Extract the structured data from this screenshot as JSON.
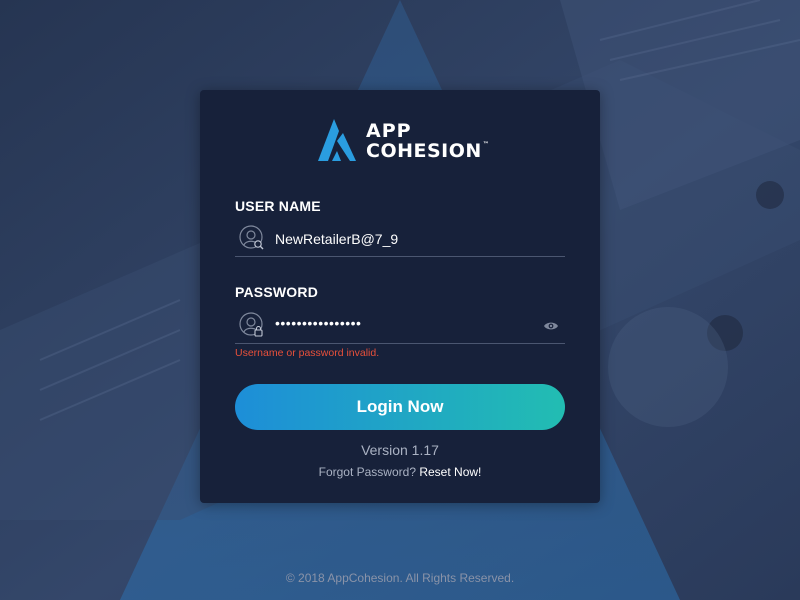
{
  "brand": {
    "logo_line1": "APP",
    "logo_line2": "COHESION",
    "logo_tm": "™",
    "accent_color": "#2a9de0"
  },
  "login": {
    "username_label": "USER NAME",
    "username_value": "NewRetailerB@7_9",
    "username_icon": "user-search-icon",
    "password_label": "PASSWORD",
    "password_masked": "••••••••••••••••",
    "password_icon": "user-lock-icon",
    "show_password_icon": "eye-icon",
    "error_message": "Username or password invalid.",
    "error_color": "#e8503a",
    "submit_label": "Login Now",
    "version_text": "Version 1.17",
    "forgot_text": "Forgot Password?",
    "reset_link": "Reset Now!"
  },
  "footer": {
    "copyright": "© 2018 AppCohesion. All Rights Reserved."
  }
}
